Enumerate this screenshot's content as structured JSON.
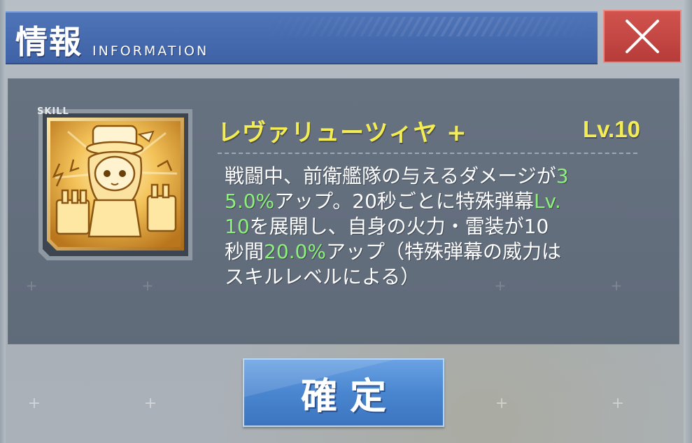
{
  "header": {
    "title": "情報",
    "subtitle": "INFORMATION",
    "close_icon": "close-x-icon"
  },
  "skill": {
    "tag": "SKILL",
    "icon": "anchor-shipgirl-skill-icon",
    "name": "レヴァリューツィヤ +",
    "level": "Lv.10",
    "description_lines": [
      [
        {
          "t": "戦闘中、前衛艦隊の与えるダメージが"
        },
        {
          "t": "3",
          "hl": true
        }
      ],
      [
        {
          "t": "5.0%",
          "hl": true
        },
        {
          "t": "アップ。20秒ごとに特殊弾幕"
        },
        {
          "t": "Lv.",
          "hl": true
        }
      ],
      [
        {
          "t": "10",
          "hl": true
        },
        {
          "t": "を展開し、自身の火力・雷装が10"
        }
      ],
      [
        {
          "t": "秒間"
        },
        {
          "t": "20.0%",
          "hl": true
        },
        {
          "t": "アップ（特殊弾幕の威力は"
        }
      ],
      [
        {
          "t": "スキルレベルによる）"
        }
      ]
    ]
  },
  "confirm": {
    "label": "確定"
  },
  "colors": {
    "title_bar": "#4a6db3",
    "close_button": "#c4463f",
    "panel": "#646f7e",
    "skill_name": "#f4ec55",
    "highlight": "#8df07a",
    "confirm_button": "#4a86d0"
  }
}
